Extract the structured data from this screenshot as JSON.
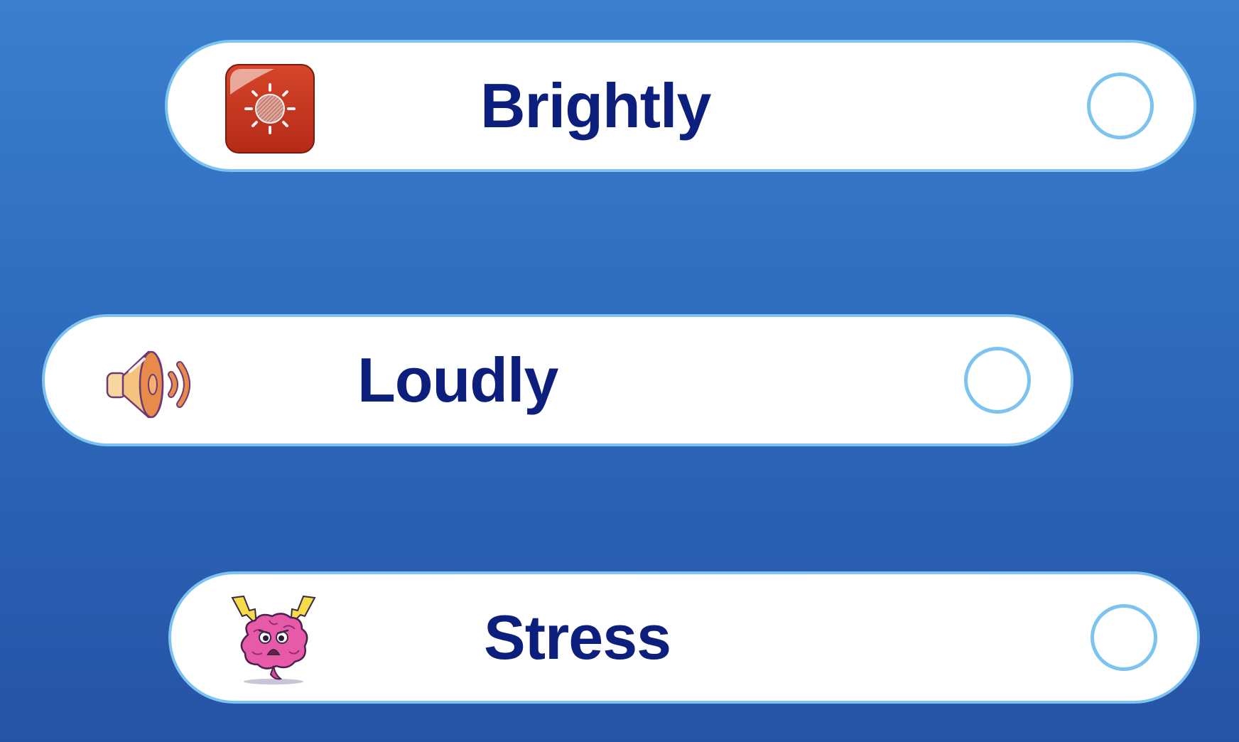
{
  "colors": {
    "background_top": "#3a80ce",
    "background_bottom": "#2653a6",
    "card_border": "#7cc3ef",
    "label_text": "#0d1f7c"
  },
  "options": [
    {
      "label": "Brightly",
      "icon": "brightness-sun-icon",
      "selected": false
    },
    {
      "label": "Loudly",
      "icon": "speaker-volume-icon",
      "selected": false
    },
    {
      "label": "Stress",
      "icon": "stressed-brain-icon",
      "selected": false
    }
  ]
}
